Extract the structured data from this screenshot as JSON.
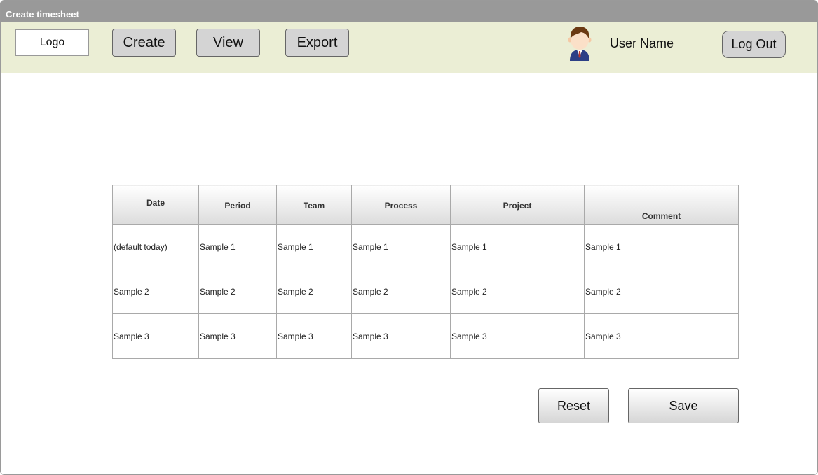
{
  "window": {
    "title": "Create timesheet"
  },
  "nav": {
    "logo": "Logo",
    "create_label": "Create",
    "view_label": "View",
    "export_label": "Export",
    "avatar_icon": "user-avatar-icon",
    "user_name": "User Name",
    "logout_label": "Log Out"
  },
  "table": {
    "headers": [
      "Date",
      "Period",
      "Team",
      "Process",
      "Project",
      "Comment"
    ],
    "rows": [
      [
        "(default today)",
        "Sample 1",
        "Sample 1",
        "Sample 1",
        "Sample 1",
        "Sample 1"
      ],
      [
        "Sample 2",
        "Sample 2",
        "Sample 2",
        "Sample 2",
        "Sample 2",
        "Sample 2"
      ],
      [
        "Sample 3",
        "Sample 3",
        "Sample 3",
        "Sample 3",
        "Sample 3",
        "Sample 3"
      ]
    ]
  },
  "actions": {
    "reset_label": "Reset",
    "save_label": "Save"
  },
  "colors": {
    "titlebar": "#999999",
    "navbar": "#ebeed5",
    "button_fill": "#d4d4d4"
  }
}
